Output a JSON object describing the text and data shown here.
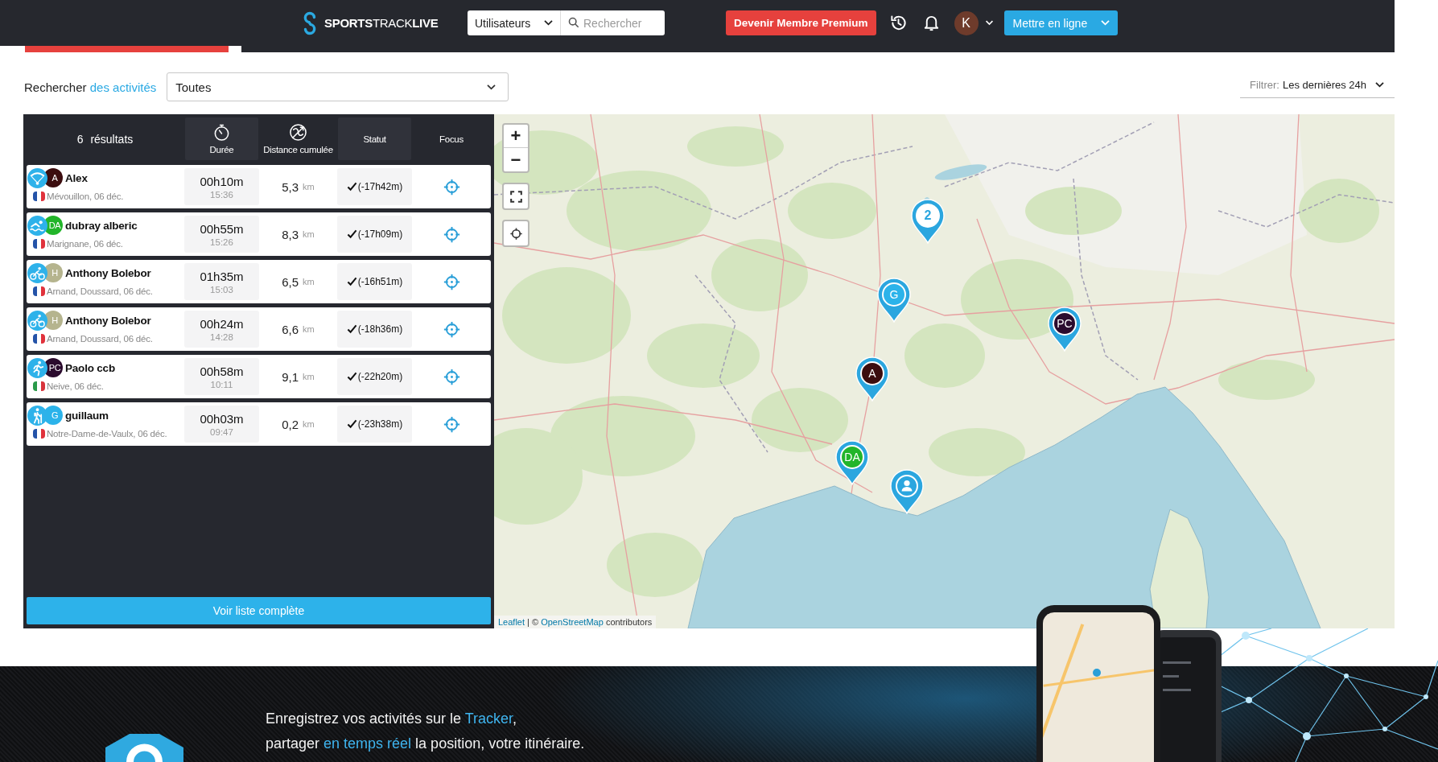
{
  "header": {
    "logo": "**SPORTS**TRACK**LIVE**",
    "users_dropdown": "Utilisateurs",
    "search": {
      "placeholder": "Rechercher"
    },
    "premium_button": "Devenir Membre Premium",
    "avatar": "K",
    "publish_button": "Mettre en ligne"
  },
  "search_bar": {
    "label": [
      {
        "text": "Rechercher ",
        "highlight": false
      },
      {
        "text": "des activités",
        "highlight": true
      }
    ],
    "activity_select": "Toutes",
    "filter": {
      "label": "Filtrer:",
      "value": "Les dernières 24h"
    }
  },
  "results": {
    "count": "6 résultats",
    "columns": [
      {
        "label": "Durée"
      },
      {
        "label": "Distance cumulée"
      },
      {
        "label": "Statut"
      },
      {
        "label": "Focus"
      }
    ],
    "rows": [
      {
        "kind": "paragliding",
        "initials": "A",
        "color": "#3c0d0f",
        "name": "Alex",
        "flag": {
          "kind": "fr"
        },
        "place": "Mévouillon, 06 déc.",
        "duration": "00h10m",
        "start_time": "15:36",
        "distance": "5,3",
        "unit": "km",
        "done": true,
        "delay": "(-17h42m)"
      },
      {
        "kind": "swimming",
        "initials": "DA",
        "color": "#22b52a",
        "name": "dubray alberic",
        "flag": {
          "kind": "fr"
        },
        "place": "Marignane, 06 déc.",
        "duration": "00h55m",
        "start_time": "15:26",
        "distance": "8,3",
        "unit": "km",
        "done": true,
        "delay": "(-17h09m)"
      },
      {
        "kind": "cycling",
        "initials": "H",
        "color": "#b5b48e",
        "name": "Anthony Bolebor",
        "flag": {
          "kind": "fr"
        },
        "place": "Arnand, Doussard, 06 déc.",
        "duration": "01h35m",
        "start_time": "15:03",
        "distance": "6,5",
        "unit": "km",
        "done": true,
        "delay": "(-16h51m)"
      },
      {
        "kind": "cycling",
        "initials": "H",
        "color": "#b5b48e",
        "name": "Anthony Bolebor",
        "flag": {
          "kind": "fr"
        },
        "place": "Arnand, Doussard, 06 déc.",
        "duration": "00h24m",
        "start_time": "14:28",
        "distance": "6,6",
        "unit": "km",
        "done": true,
        "delay": "(-18h36m)"
      },
      {
        "kind": "running",
        "initials": "PC",
        "color": "#2b0b2e",
        "name": "Paolo ccb",
        "flag": {
          "kind": "it"
        },
        "place": "Neive, 06 déc.",
        "duration": "00h58m",
        "start_time": "10:11",
        "distance": "9,1",
        "unit": "km",
        "done": true,
        "delay": "(-22h20m)"
      },
      {
        "kind": "hiking",
        "initials": "G",
        "color": "#2bb3ea",
        "name": "guillaum",
        "flag": {
          "kind": "fr"
        },
        "place": "Notre-Dame-de-Vaulx, 06 déc.",
        "duration": "00h03m",
        "start_time": "09:47",
        "distance": "0,2",
        "unit": "km",
        "done": true,
        "delay": "(-23h38m)"
      }
    ],
    "more_button": "Voir liste complète"
  },
  "map": {
    "zoom_in": "+",
    "zoom_out": "−",
    "markers": [
      {
        "kind": "cluster",
        "label": "2"
      },
      {
        "kind": "avatar",
        "label": "G",
        "color": "#2bb3ea"
      },
      {
        "kind": "avatar",
        "label": "PC",
        "color": "#2b0b2e"
      },
      {
        "kind": "avatar",
        "label": "A",
        "color": "#3c0d0f"
      },
      {
        "kind": "avatar",
        "label": "DA",
        "color": "#22b52a"
      },
      {
        "kind": "user"
      }
    ],
    "attribution": [
      {
        "text": "Leaflet",
        "link": true
      },
      {
        "text": " | © ",
        "link": false
      },
      {
        "text": "OpenStreetMap",
        "link": true
      },
      {
        "text": " contributors",
        "link": false
      }
    ]
  },
  "banner": {
    "lines": [
      [
        {
          "text": "Enregistrez vos activités sur le ",
          "highlight": false
        },
        {
          "text": "Tracker",
          "highlight": true
        },
        {
          "text": ",",
          "highlight": false
        }
      ],
      [
        {
          "text": "partager ",
          "highlight": false
        },
        {
          "text": "en temps réel",
          "highlight": true
        },
        {
          "text": " la position, votre itinéraire.",
          "highlight": false
        }
      ]
    ]
  }
}
